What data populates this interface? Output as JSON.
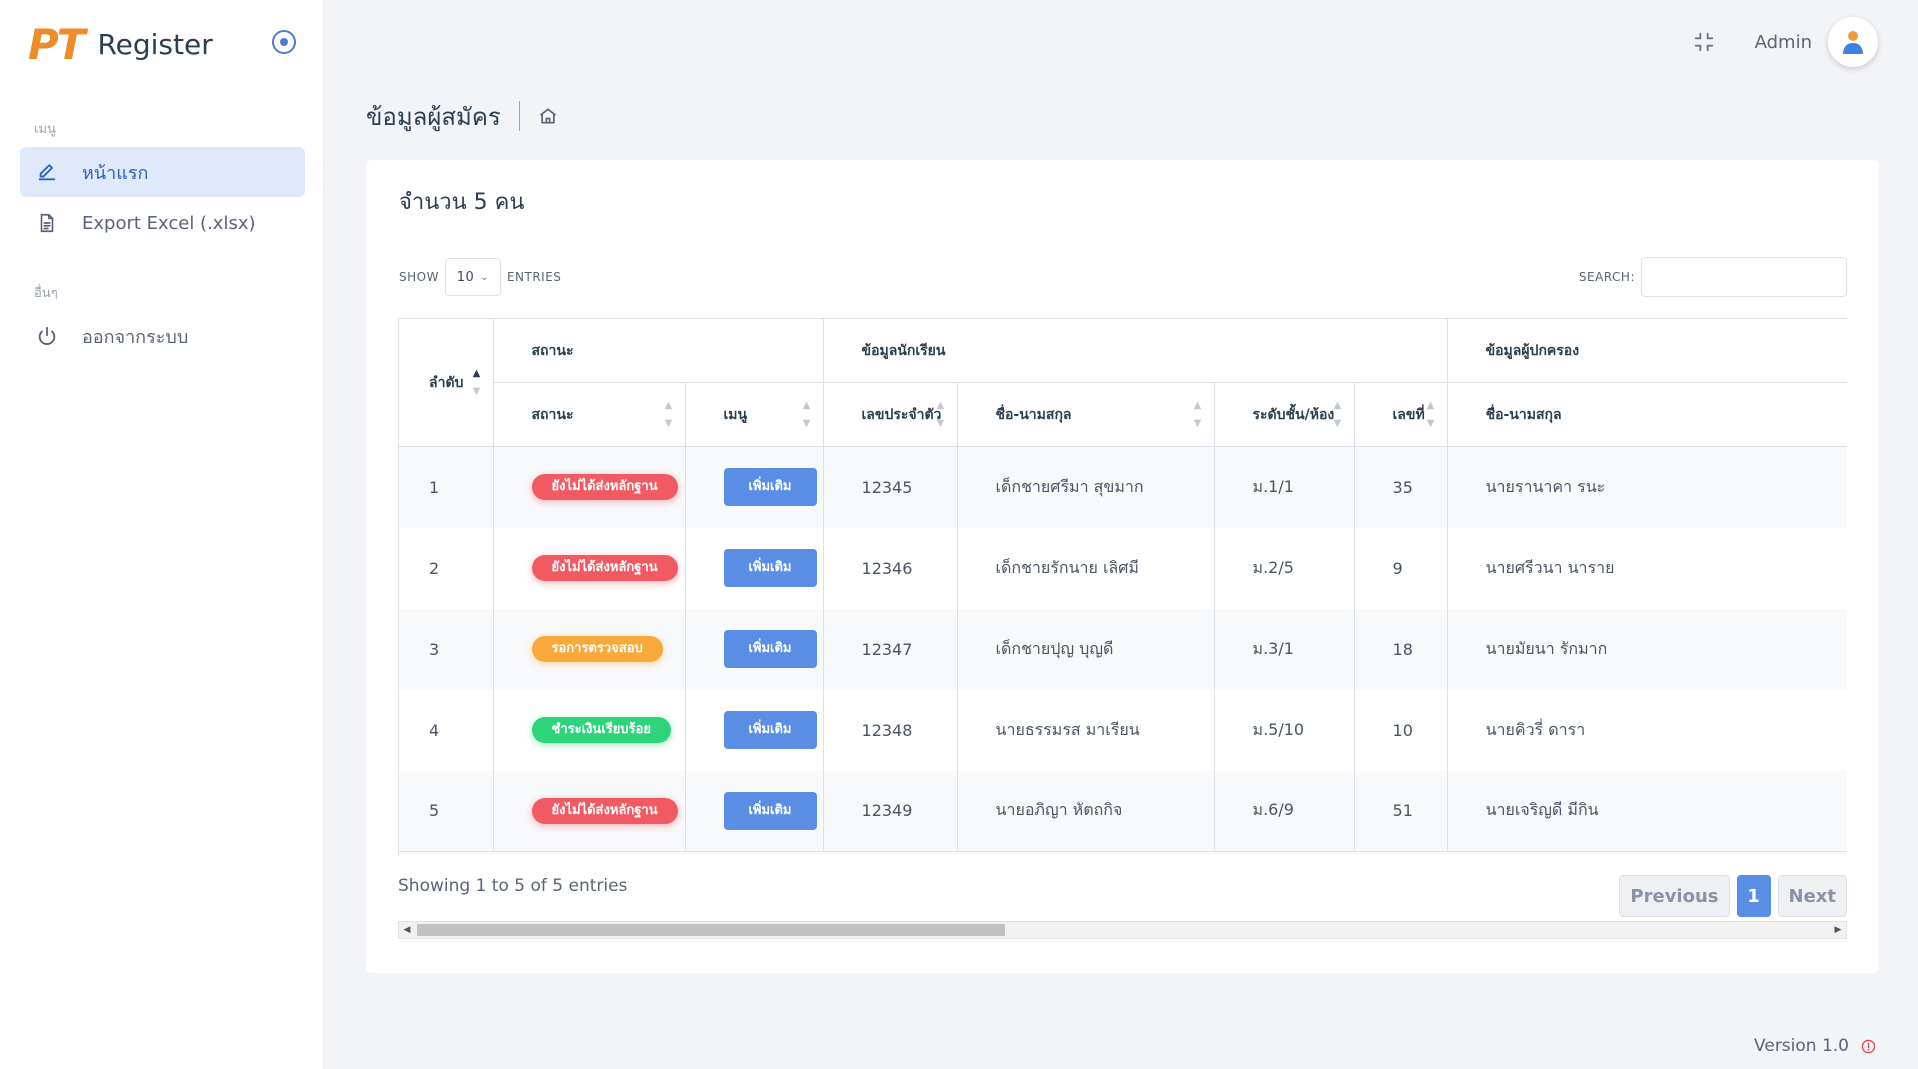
{
  "brand": {
    "logo": "PT",
    "name": "Register"
  },
  "sidebar": {
    "section_menu": "เมนู",
    "section_other": "อื่นๆ",
    "items": [
      {
        "label": "หน้าแรก",
        "icon": "edit-icon",
        "active": true
      },
      {
        "label": "Export Excel (.xlsx)",
        "icon": "document-icon",
        "active": false
      },
      {
        "label": "ออกจากระบบ",
        "icon": "power-icon",
        "active": false
      }
    ]
  },
  "header": {
    "user": "Admin"
  },
  "page": {
    "title": "ข้อมูลผู้สมัคร"
  },
  "card": {
    "title": "จำนวน 5 คน",
    "show_label": "SHOW",
    "show_value": "10",
    "entries_label": "ENTRIES",
    "search_label": "SEARCH:",
    "search_value": ""
  },
  "table": {
    "group_headers": [
      "ลำดับ",
      "สถานะ",
      "ข้อมูลนักเรียน",
      "ข้อมูลผู้ปกครอง"
    ],
    "sub_headers": [
      "สถานะ",
      "เมนู",
      "เลขประจำตัว",
      "ชื่อ-นามสกุล",
      "ระดับชั้น/ห้อง",
      "เลขที่",
      "ชื่อ-นามสกุล"
    ],
    "rows": [
      {
        "no": "1",
        "status": "ยังไม่ได้ส่งหลักฐาน",
        "status_color": "red",
        "menu": "เพิ่มเติม",
        "id": "12345",
        "name": "เด็กชายศรีมา สุขมาก",
        "class": "ม.1/1",
        "num": "35",
        "parent": "นายรานาคา รนะ"
      },
      {
        "no": "2",
        "status": "ยังไม่ได้ส่งหลักฐาน",
        "status_color": "red",
        "menu": "เพิ่มเติม",
        "id": "12346",
        "name": "เด็กชายรักนาย เลิศมี",
        "class": "ม.2/5",
        "num": "9",
        "parent": "นายศรีวนา นาราย"
      },
      {
        "no": "3",
        "status": "รอการตรวจสอบ",
        "status_color": "orange",
        "menu": "เพิ่มเติม",
        "id": "12347",
        "name": "เด็กชายปุญ บุญดี",
        "class": "ม.3/1",
        "num": "18",
        "parent": "นายมัยนา รักมาก"
      },
      {
        "no": "4",
        "status": "ชำระเงินเรียบร้อย",
        "status_color": "green",
        "menu": "เพิ่มเติม",
        "id": "12348",
        "name": "นายธรรมรส มาเรียน",
        "class": "ม.5/10",
        "num": "10",
        "parent": "นายคิวรี่ ดารา"
      },
      {
        "no": "5",
        "status": "ยังไม่ได้ส่งหลักฐาน",
        "status_color": "red",
        "menu": "เพิ่มเติม",
        "id": "12349",
        "name": "นายอภิญา หัตถกิจ",
        "class": "ม.6/9",
        "num": "51",
        "parent": "นายเจริญดี มีกิน"
      }
    ]
  },
  "footer": {
    "info": "Showing 1 to 5 of 5 entries",
    "prev": "Previous",
    "page": "1",
    "next": "Next",
    "version": "Version 1.0"
  },
  "colors": {
    "accent": "#5a8de4",
    "brand": "#ef8c2a",
    "danger": "#f25a63",
    "warning": "#f8a93a",
    "success": "#2ed47a"
  }
}
